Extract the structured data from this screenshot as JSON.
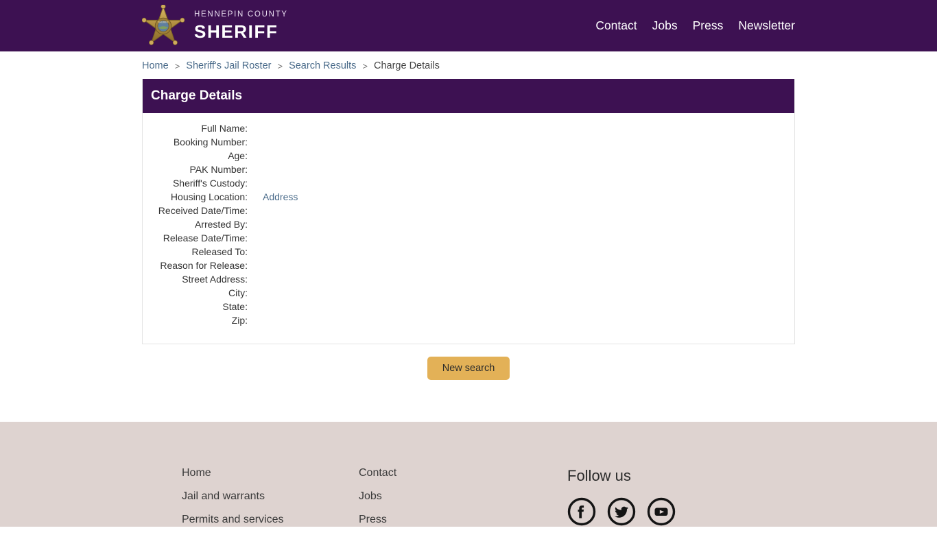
{
  "header": {
    "brand_top": "HENNEPIN COUNTY",
    "brand_main": "SHERIFF",
    "badge_icon": "sheriff-star-badge-icon",
    "nav": [
      {
        "label": "Contact"
      },
      {
        "label": "Jobs"
      },
      {
        "label": "Press"
      },
      {
        "label": "Newsletter"
      }
    ],
    "colors": {
      "background": "#3d1152",
      "text": "#ffffff"
    }
  },
  "breadcrumb": {
    "separator": ">",
    "items": [
      {
        "label": "Home",
        "is_link": true
      },
      {
        "label": "Sheriff's Jail Roster",
        "is_link": true
      },
      {
        "label": "Search Results",
        "is_link": true
      },
      {
        "label": "Charge Details",
        "is_link": false
      }
    ],
    "link_color": "#4a6b8a"
  },
  "card": {
    "title": "Charge Details",
    "header_background": "#3d1152",
    "fields": [
      {
        "label": "Full Name:",
        "value": ""
      },
      {
        "label": "Booking Number:",
        "value": ""
      },
      {
        "label": "Age:",
        "value": ""
      },
      {
        "label": "PAK Number:",
        "value": ""
      },
      {
        "label": "Sheriff's Custody:",
        "value": ""
      },
      {
        "label": "Housing Location:",
        "value": "Address",
        "is_link": true
      },
      {
        "label": "Received Date/Time:",
        "value": ""
      },
      {
        "label": "Arrested By:",
        "value": ""
      },
      {
        "label": "Release Date/Time:",
        "value": ""
      },
      {
        "label": "Released To:",
        "value": ""
      },
      {
        "label": "Reason for Release:",
        "value": ""
      },
      {
        "label": "Street Address:",
        "value": ""
      },
      {
        "label": "City:",
        "value": ""
      },
      {
        "label": "State:",
        "value": ""
      },
      {
        "label": "Zip:",
        "value": ""
      }
    ]
  },
  "actions": {
    "new_search_label": "New search",
    "new_search_color": "#e3b157"
  },
  "footer": {
    "background": "#ded3d0",
    "column_1": [
      {
        "label": "Home"
      },
      {
        "label": "Jail and warrants"
      },
      {
        "label": "Permits and services"
      }
    ],
    "column_2": [
      {
        "label": "Contact"
      },
      {
        "label": "Jobs"
      },
      {
        "label": "Press"
      }
    ],
    "follow_title": "Follow us",
    "social": [
      {
        "name": "facebook-icon"
      },
      {
        "name": "twitter-icon"
      },
      {
        "name": "youtube-icon"
      }
    ]
  }
}
